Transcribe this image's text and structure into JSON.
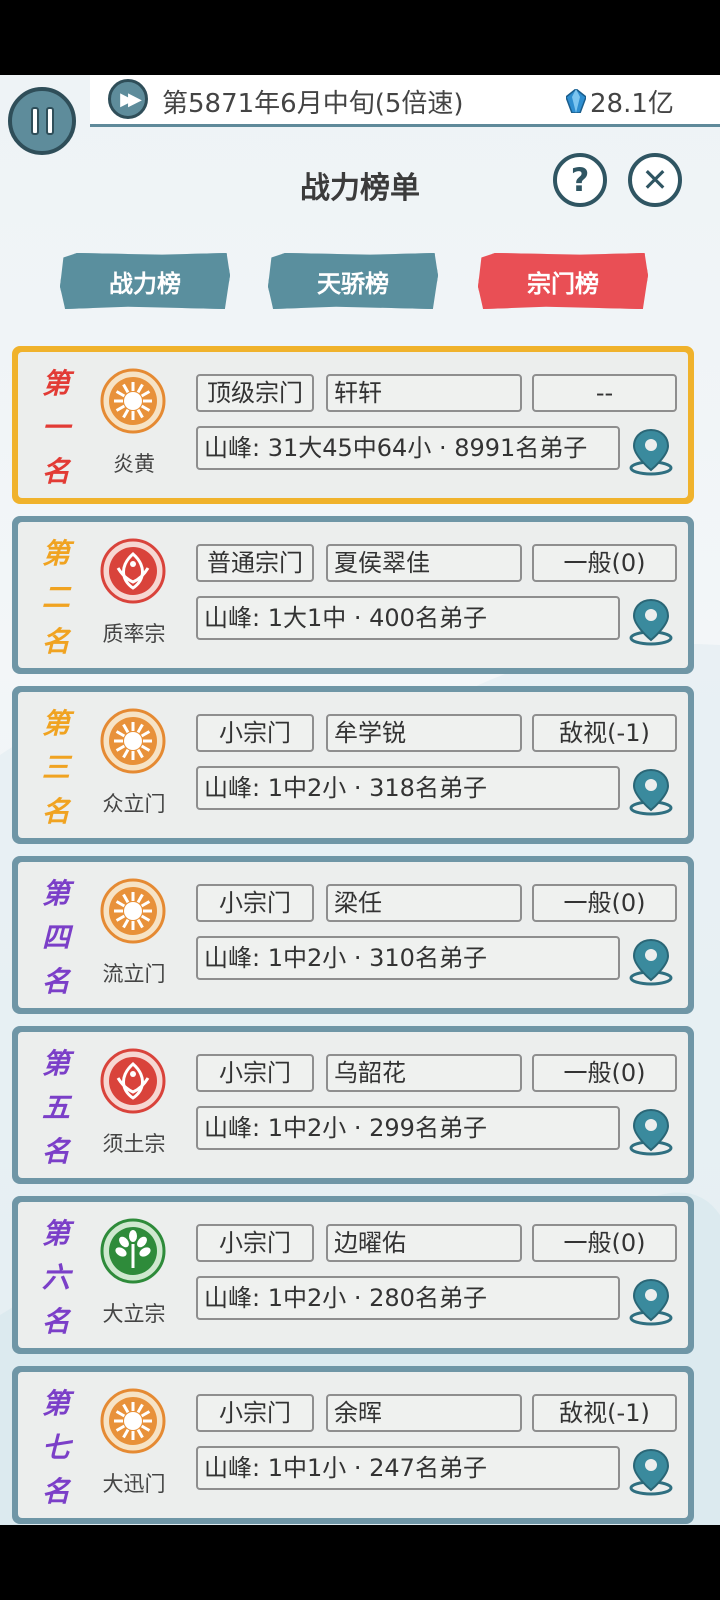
{
  "topbar": {
    "date_text": "第5871年6月中旬(5倍速)",
    "currency": "28.1亿"
  },
  "title": "战力榜单",
  "buttons": {
    "help": "?",
    "close": "✕"
  },
  "tabs": [
    {
      "label": "战力榜",
      "active": false
    },
    {
      "label": "天骄榜",
      "active": false
    },
    {
      "label": "宗门榜",
      "active": true
    }
  ],
  "ranks": [
    {
      "rank_chars": [
        "第",
        "一",
        "名"
      ],
      "rank_color": "#e23b35",
      "emblem": "sun-emblem",
      "sect": "炎黄",
      "level": "顶级宗门",
      "leader": "轩轩",
      "relation": "--",
      "info": "山峰: 31大45中64小 · 8991名弟子",
      "highlight": true
    },
    {
      "rank_chars": [
        "第",
        "二",
        "名"
      ],
      "rank_color": "#f0a321",
      "emblem": "phoenix-emblem",
      "sect": "质率宗",
      "level": "普通宗门",
      "leader": "夏侯翠佳",
      "relation": "一般(0)",
      "info": "山峰: 1大1中 · 400名弟子",
      "highlight": false
    },
    {
      "rank_chars": [
        "第",
        "三",
        "名"
      ],
      "rank_color": "#f0a321",
      "emblem": "sun-emblem",
      "sect": "众立门",
      "level": "小宗门",
      "leader": "牟学锐",
      "relation": "敌视(-1)",
      "info": "山峰: 1中2小 · 318名弟子",
      "highlight": false
    },
    {
      "rank_chars": [
        "第",
        "四",
        "名"
      ],
      "rank_color": "#7b3fc8",
      "emblem": "sun-emblem",
      "sect": "流立门",
      "level": "小宗门",
      "leader": "梁任",
      "relation": "一般(0)",
      "info": "山峰: 1中2小 · 310名弟子",
      "highlight": false
    },
    {
      "rank_chars": [
        "第",
        "五",
        "名"
      ],
      "rank_color": "#7b3fc8",
      "emblem": "phoenix-emblem",
      "sect": "须土宗",
      "level": "小宗门",
      "leader": "乌韶花",
      "relation": "一般(0)",
      "info": "山峰: 1中2小 · 299名弟子",
      "highlight": false
    },
    {
      "rank_chars": [
        "第",
        "六",
        "名"
      ],
      "rank_color": "#7b3fc8",
      "emblem": "tree-emblem",
      "sect": "大立宗",
      "level": "小宗门",
      "leader": "边曜佑",
      "relation": "一般(0)",
      "info": "山峰: 1中2小 · 280名弟子",
      "highlight": false
    },
    {
      "rank_chars": [
        "第",
        "七",
        "名"
      ],
      "rank_color": "#7b3fc8",
      "emblem": "sun-emblem",
      "sect": "大迅门",
      "level": "小宗门",
      "leader": "余晖",
      "relation": "敌视(-1)",
      "info": "山峰: 1中1小 · 247名弟子",
      "highlight": false
    }
  ]
}
